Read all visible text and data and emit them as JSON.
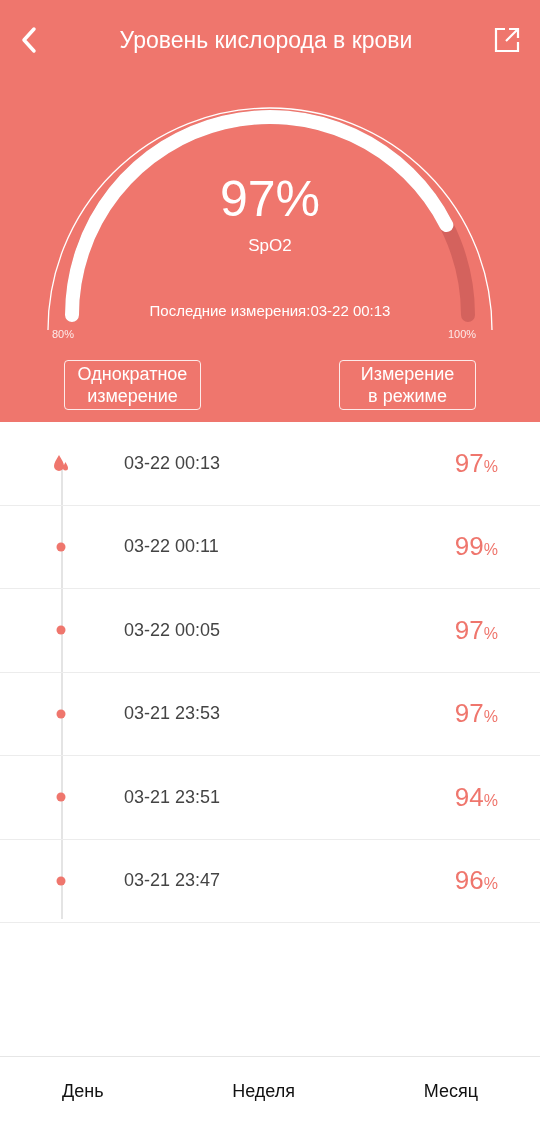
{
  "header": {
    "title": "Уровень кислорода в крови"
  },
  "gauge": {
    "value": "97%",
    "label": "SpO2",
    "last_measurement": "Последние измерения:03-22 00:13",
    "min_label": "80%",
    "max_label": "100%"
  },
  "actions": [
    "Однократное измерение",
    "Измерение в режиме"
  ],
  "records": [
    {
      "kind": "drop",
      "time": "03-22 00:13",
      "value": "97",
      "unit": "%"
    },
    {
      "kind": "dot",
      "time": "03-22 00:11",
      "value": "99",
      "unit": "%"
    },
    {
      "kind": "dot",
      "time": "03-22 00:05",
      "value": "97",
      "unit": "%"
    },
    {
      "kind": "dot",
      "time": "03-21 23:53",
      "value": "97",
      "unit": "%"
    },
    {
      "kind": "dot",
      "time": "03-21 23:51",
      "value": "94",
      "unit": "%"
    },
    {
      "kind": "dot",
      "time": "03-21 23:47",
      "value": "96",
      "unit": "%"
    }
  ],
  "tabs": [
    {
      "label": "День"
    },
    {
      "label": "Неделя"
    },
    {
      "label": "Месяц"
    }
  ]
}
